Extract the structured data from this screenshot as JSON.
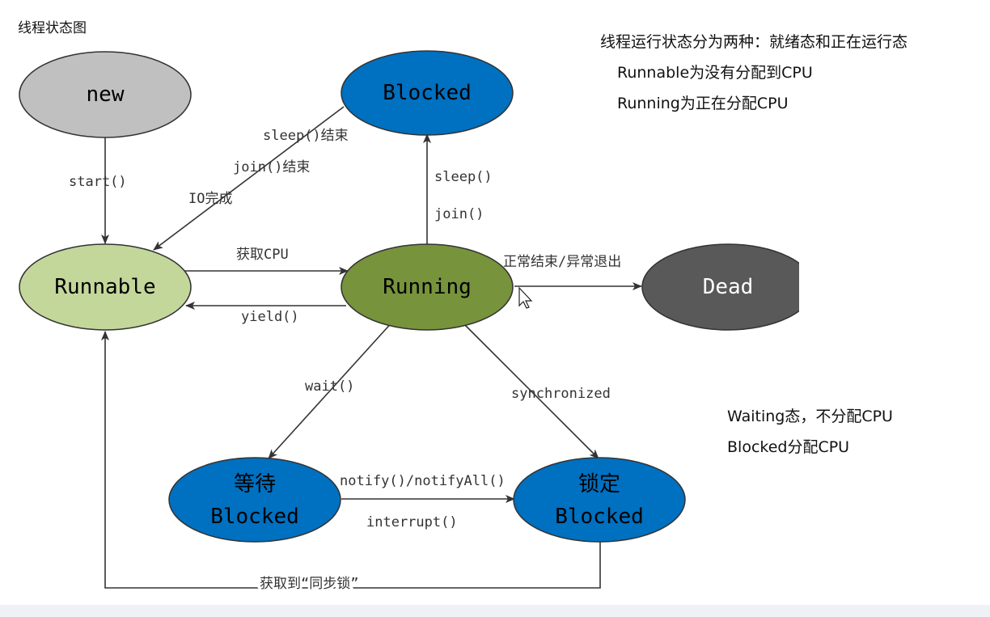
{
  "title": "线程状态图",
  "notes": {
    "running_states": "线程运行状态分为两种：就绪态和正在运行态",
    "runnable_desc": "Runnable为没有分配到CPU",
    "running_desc": "Running为正在分配CPU",
    "waiting_desc": "Waiting态，不分配CPU",
    "blocked_desc": "Blocked分配CPU"
  },
  "nodes": {
    "new": {
      "label": "new",
      "fill": "#c0c0c0",
      "text_color": "#000000"
    },
    "blocked": {
      "label": "Blocked",
      "fill": "#0070c0",
      "text_color": "#000000"
    },
    "runnable": {
      "label": "Runnable",
      "fill": "#c4d79b",
      "text_color": "#000000"
    },
    "running": {
      "label": "Running",
      "fill": "#77933c",
      "text_color": "#000000"
    },
    "dead": {
      "label": "Dead",
      "fill": "#595959",
      "text_color": "#ffffff"
    },
    "waiting": {
      "label_line1": "等待",
      "label_line2": "Blocked",
      "fill": "#0070c0",
      "text_color": "#000000"
    },
    "locked": {
      "label_line1": "锁定",
      "label_line2": "Blocked",
      "fill": "#0070c0",
      "text_color": "#000000"
    }
  },
  "edges": {
    "start": "start()",
    "sleep_end": "sleep()结束",
    "join_end": "join()结束",
    "io_done": "IO完成",
    "sleep": "sleep()",
    "join": "join()",
    "get_cpu": "获取CPU",
    "yield": "yield()",
    "finish": "正常结束/异常退出",
    "wait": "wait()",
    "synchronized": "synchronized",
    "notify": "notify()/notifyAll()",
    "interrupt": "interrupt()",
    "get_lock": "获取到“同步锁”"
  }
}
